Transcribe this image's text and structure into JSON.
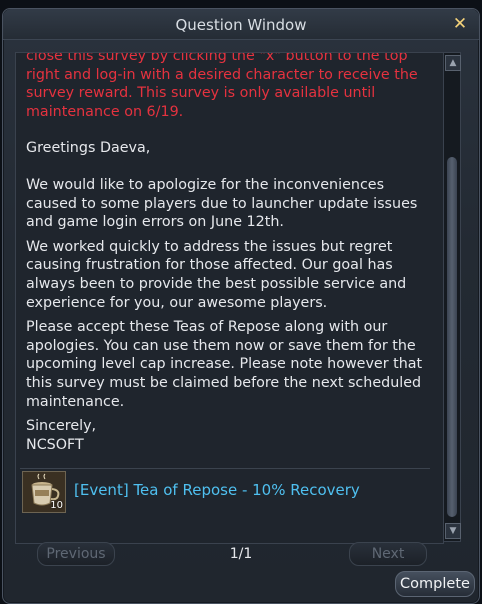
{
  "window": {
    "title": "Question Window",
    "close_symbol": "✕"
  },
  "content": {
    "warning_lines": [
      "close this survey by clicking the \"x\" button to the top",
      "right and log-in with a desired character to receive the",
      "survey reward. This survey is only available until",
      "maintenance on 6/19."
    ],
    "greeting": "Greetings Daeva,",
    "paragraph1": [
      "We would like to apologize for the inconveniences",
      "caused to some players due to launcher update issues",
      "and game login errors on June 12th."
    ],
    "paragraph2": [
      "We worked quickly to address the issues but regret",
      "causing frustration for those affected. Our goal has",
      "always been to provide the best possible service and",
      "experience for you, our awesome players."
    ],
    "paragraph3": [
      "Please accept these Teas of Repose along with our",
      "apologies. You can use them now or save them for the",
      "upcoming level cap increase. Please note however that",
      "this survey must be claimed before the next scheduled",
      "maintenance."
    ],
    "closing": "Sincerely,",
    "signature": "NCSOFT"
  },
  "reward": {
    "name": "[Event] Tea of Repose - 10% Recovery",
    "count": "10",
    "icon": "tea-cup-icon"
  },
  "pagination": {
    "previous_label": "Previous",
    "next_label": "Next",
    "page": "1/1"
  },
  "actions": {
    "complete_label": "Complete"
  },
  "colors": {
    "warning": "#e5323f",
    "link": "#4fc0f0",
    "close": "#f4d27a"
  }
}
